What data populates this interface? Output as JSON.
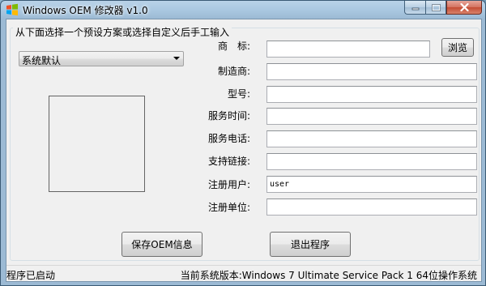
{
  "window": {
    "title": "Windows OEM 修改器 v1.0"
  },
  "group": {
    "legend": "从下面选择一个预设方案或选择自定义后手工输入"
  },
  "preset": {
    "selected": "系统默认"
  },
  "fields": {
    "logo": {
      "label": "商　标:",
      "value": ""
    },
    "manufacturer": {
      "label": "制造商:",
      "value": ""
    },
    "model": {
      "label": "型号:",
      "value": ""
    },
    "support_hours": {
      "label": "服务时间:",
      "value": ""
    },
    "support_phone": {
      "label": "服务电话:",
      "value": ""
    },
    "support_url": {
      "label": "支持链接:",
      "value": ""
    },
    "registered_owner": {
      "label": "注册用户:",
      "value": "user"
    },
    "registered_org": {
      "label": "注册单位:",
      "value": ""
    }
  },
  "buttons": {
    "browse": "浏览",
    "save": "保存OEM信息",
    "exit": "退出程序"
  },
  "status": {
    "left": "程序已启动",
    "right": "当前系统版本:Windows 7 Ultimate Service Pack 1 64位操作系统"
  },
  "icons": {
    "app": "windows-logo-icon",
    "minimize": "minimize-icon",
    "maximize": "maximize-icon",
    "close": "close-icon",
    "dropdown": "chevron-down-icon"
  }
}
